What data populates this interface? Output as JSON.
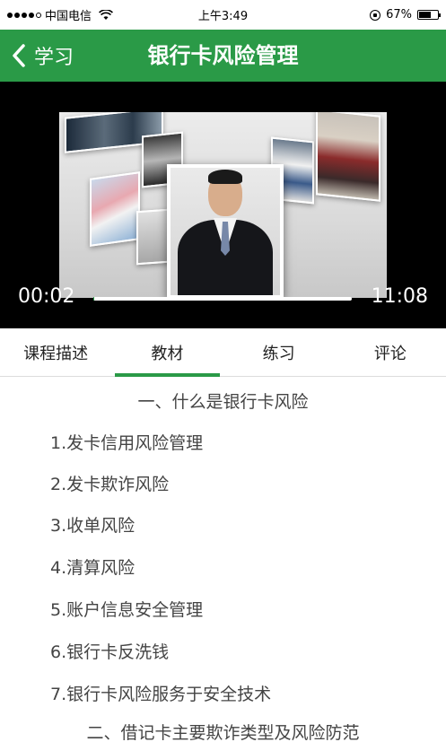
{
  "status_bar": {
    "carrier": "中国电信",
    "time": "上午3:49",
    "battery": "67%",
    "battery_level": 0.67
  },
  "nav": {
    "back_label": "学习",
    "title": "银行卡风险管理"
  },
  "video": {
    "current_time": "00:02",
    "total_time": "11:08"
  },
  "tabs": [
    {
      "label": "课程描述",
      "active": false
    },
    {
      "label": "教材",
      "active": true
    },
    {
      "label": "练习",
      "active": false
    },
    {
      "label": "评论",
      "active": false
    }
  ],
  "content": {
    "section1_title": "一、什么是银行卡风险",
    "items": [
      "1.发卡信用风险管理",
      "2.发卡欺诈风险",
      "3.收单风险",
      "4.清算风险",
      "5.账户信息安全管理",
      "6.银行卡反洗钱",
      "7.银行卡风险服务于安全技术"
    ],
    "section2_title": "二、借记卡主要欺诈类型及风险防范"
  },
  "colors": {
    "brand_green": "#2a9a47"
  }
}
